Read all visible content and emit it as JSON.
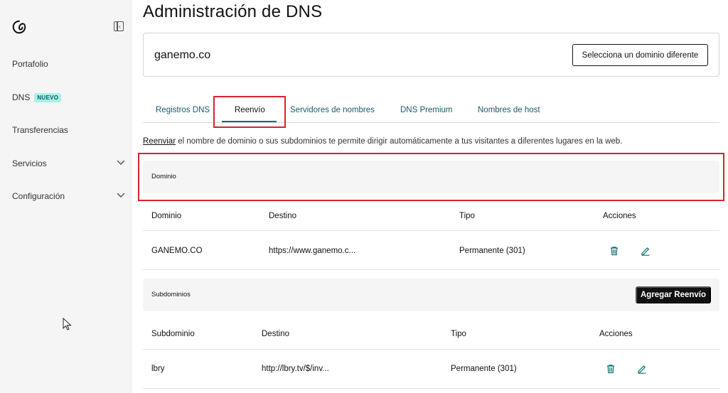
{
  "sidebar": {
    "logo_icon": "godaddy-logo-icon",
    "collapse_icon": "collapse-sidebar-icon",
    "items": [
      {
        "label": "Portafolio"
      },
      {
        "label": "DNS",
        "badge": "NUEVO"
      },
      {
        "label": "Transferencias"
      },
      {
        "label": "Servicios",
        "chevron": "chevron-down-icon"
      },
      {
        "label": "Configuración",
        "chevron": "chevron-down-icon"
      }
    ]
  },
  "page": {
    "title": "Administración de DNS"
  },
  "domain_card": {
    "domain": "ganemo.co",
    "select_button": "Selecciona un dominio diferente"
  },
  "tabs": [
    {
      "label": "Registros DNS",
      "active": false
    },
    {
      "label": "Reenvío",
      "active": true
    },
    {
      "label": "Servidores de nombres",
      "active": false
    },
    {
      "label": "DNS Premium",
      "active": false
    },
    {
      "label": "Nombres de host",
      "active": false
    }
  ],
  "description": {
    "link": "Reenviar",
    "text": " el nombre de dominio o sus subdominios te permite dirigir automáticamente a tus visitantes a diferentes lugares en la web."
  },
  "domain_section": {
    "heading": "Dominio",
    "columns": [
      "Dominio",
      "Destino",
      "Tipo",
      "Acciones"
    ],
    "rows": [
      {
        "name": "GANEMO.CO",
        "destination": "https://www.ganemo.c...",
        "type": "Permanente (301)"
      }
    ]
  },
  "subdomain_section": {
    "heading": "Subdominios",
    "add_button": "Agregar Reenvío",
    "columns": [
      "Subdominio",
      "Destino",
      "Tipo",
      "Acciones"
    ],
    "rows": [
      {
        "name": "lbry",
        "destination": "http://lbry.tv/$/inv...",
        "type": "Permanente (301)"
      }
    ]
  },
  "colors": {
    "accent": "#0b6e70",
    "highlight": "#d9232d",
    "tab_text": "#1a5a63",
    "badge_bg": "#a8f0ec"
  }
}
